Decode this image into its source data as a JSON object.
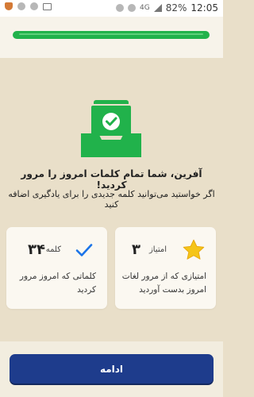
{
  "status_bar": {
    "network_label": "4G",
    "battery": "82%",
    "time": "12:05"
  },
  "progress": {
    "fraction": 1.0,
    "color": "#21b24b"
  },
  "completion": {
    "title": "آفرین، شما تمام کلمات امروز را مرور کردید!",
    "subtitle": "اگر خواستید می‌توانید کلمه جدیدی را برای یادگیری اضافه کنید"
  },
  "cards": {
    "points": {
      "value": "۳",
      "unit": "امتیاز",
      "description": "امتیازی که از مرور لغات امروز بدست آوردید",
      "icon": "star-icon"
    },
    "words": {
      "value": "۳۴",
      "unit": "کلمه",
      "description": "کلماتی که امروز مرور کردید",
      "icon": "checkmark-icon"
    }
  },
  "actions": {
    "continue_label": "ادامه"
  },
  "colors": {
    "accent_green": "#21b24b",
    "button_blue": "#1e3c8c",
    "star_yellow": "#f5c518",
    "check_blue": "#1a73e8"
  }
}
